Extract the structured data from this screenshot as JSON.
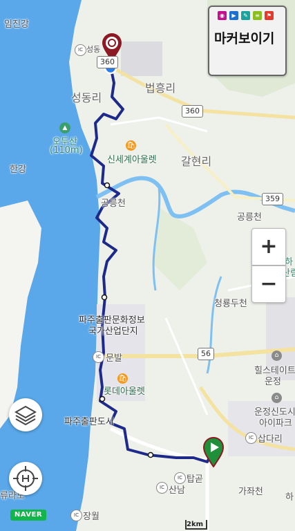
{
  "map": {
    "places": [
      {
        "key": "imjingang",
        "text": "임진강"
      },
      {
        "key": "seongdong_ic",
        "text": "성동"
      },
      {
        "key": "seongdongri",
        "text": "성동리"
      },
      {
        "key": "beopheungri",
        "text": "법흥리"
      },
      {
        "key": "odusan",
        "text": "오두산"
      },
      {
        "key": "odusan_height",
        "text": "(110m)"
      },
      {
        "key": "hangang",
        "text": "한강"
      },
      {
        "key": "shinsegae",
        "text": "신세계아울렛"
      },
      {
        "key": "galhyeonri",
        "text": "갈현리"
      },
      {
        "key": "gongneungcheon_1",
        "text": "공릉천"
      },
      {
        "key": "gongneungcheon_2",
        "text": "공릉천"
      },
      {
        "key": "cheongryongducheon",
        "text": "청룡두천"
      },
      {
        "key": "paju_culture_1",
        "text": "파주출판문화정보"
      },
      {
        "key": "paju_culture_2",
        "text": "국가산업단지"
      },
      {
        "key": "munbal",
        "text": "문발"
      },
      {
        "key": "lotte",
        "text": "롯데아울렛"
      },
      {
        "key": "hillstate_1",
        "text": "힐스테이트"
      },
      {
        "key": "hillstate_2",
        "text": "운정"
      },
      {
        "key": "unjeong_1",
        "text": "운정신도시"
      },
      {
        "key": "unjeong_2",
        "text": "아이파크"
      },
      {
        "key": "paju_publishing",
        "text": "파주출판도시"
      },
      {
        "key": "sapdari",
        "text": "삽다리"
      },
      {
        "key": "tapgol",
        "text": "탑곧"
      },
      {
        "key": "sannam",
        "text": "산남"
      },
      {
        "key": "gajwacheon",
        "text": "가좌천"
      },
      {
        "key": "jangwol",
        "text": "장월"
      },
      {
        "key": "ryurado",
        "text": "류라도"
      },
      {
        "key": "ha_1",
        "text": "하"
      },
      {
        "key": "ha_2",
        "text": "산림"
      },
      {
        "key": "ha_3",
        "text": "하"
      }
    ],
    "roads": [
      {
        "key": "r360a",
        "text": "360"
      },
      {
        "key": "r360b",
        "text": "360"
      },
      {
        "key": "r359",
        "text": "359"
      },
      {
        "key": "r56",
        "text": "56"
      }
    ],
    "ic_badge": "IC"
  },
  "marker_box": {
    "title": "마커보이기",
    "icon_colors": [
      "#c1118c",
      "#1f6fd1",
      "#1aa39a",
      "#8bbf1f",
      "#e23b2b"
    ]
  },
  "controls": {
    "zoom_in": "+",
    "zoom_out": "−"
  },
  "branding": {
    "naver": "NAVER"
  },
  "scale": {
    "label": "2km"
  },
  "colors": {
    "water": "#5aa8ea",
    "route": "#1e2a8a",
    "land": "#eef0ea",
    "start_marker": "#8c1a24",
    "end_marker": "#1f8f3a",
    "current_location": "#2b7de9"
  }
}
